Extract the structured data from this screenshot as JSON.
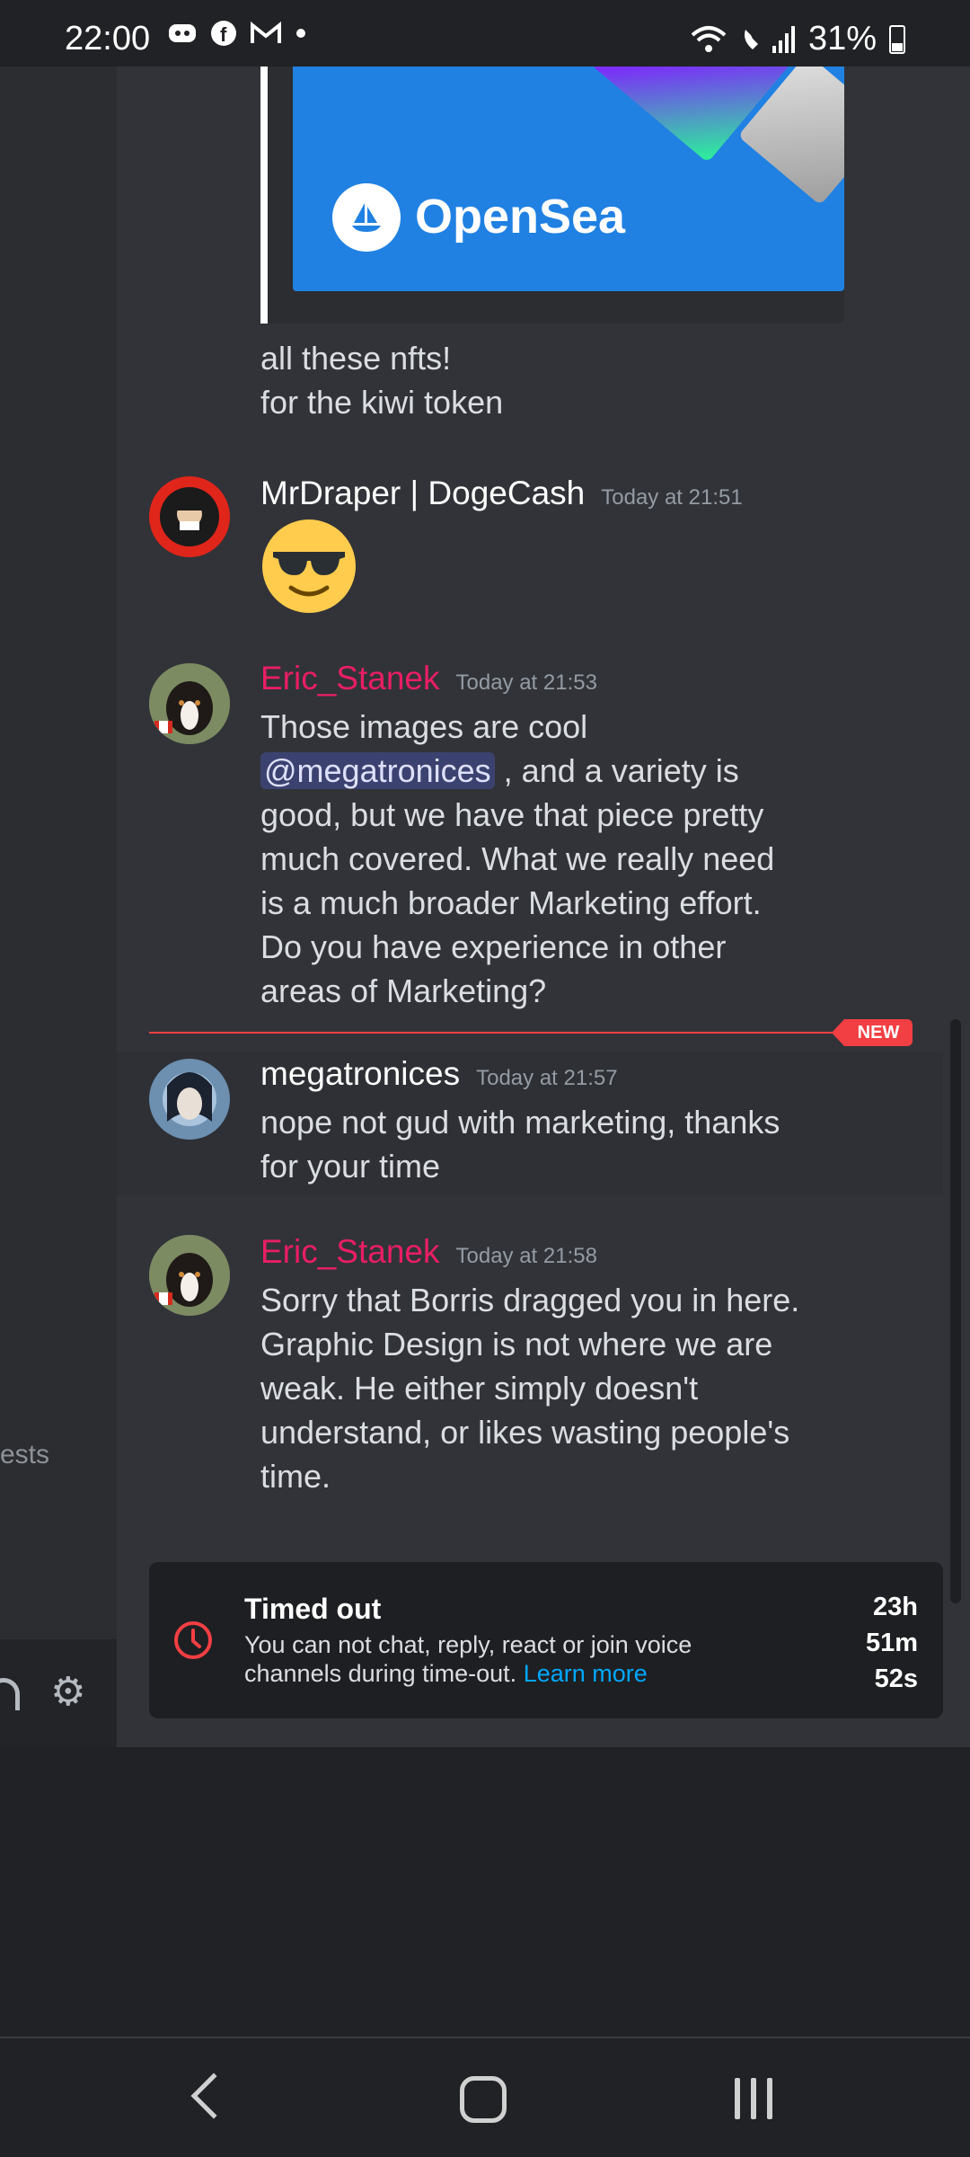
{
  "status_bar": {
    "time": "22:00",
    "notification_icons": [
      "discord-icon",
      "facebook-icon",
      "gmail-icon",
      "dot-icon"
    ],
    "battery": "31%"
  },
  "sidebar": {
    "fragment_text": "ests"
  },
  "embed": {
    "brand": "OpenSea"
  },
  "messages": [
    {
      "lines": [
        "all these nfts!",
        "for the kiwi token"
      ]
    },
    {
      "author": "MrDraper | DogeCash",
      "author_color": "#ffffff",
      "timestamp": "Today at 21:51",
      "emoji": "sunglasses-emoji"
    },
    {
      "author": "Eric_Stanek",
      "author_color": "#e91e63",
      "timestamp": "Today at 21:53",
      "line1": "Those images are cool",
      "mention": "@megatronices",
      "line2_rest": ", and a variety is",
      "line3": "good, but we have that piece pretty",
      "line4": "much covered. What we really need",
      "line5": "is a much broader Marketing effort.",
      "line6": "Do you have experience in other",
      "line7": "areas of Marketing?"
    },
    {
      "author": "megatronices",
      "author_color": "#ffffff",
      "timestamp": "Today at 21:57",
      "line1": "nope not gud with marketing, thanks",
      "line2": "for your time"
    },
    {
      "author": "Eric_Stanek",
      "author_color": "#e91e63",
      "timestamp": "Today at 21:58",
      "line1": "Sorry that Borris dragged you in here.",
      "line2": "Graphic Design is not where we are",
      "line3": "weak. He either simply doesn't",
      "line4": "understand, or likes wasting people's",
      "line5": "time."
    }
  ],
  "new_badge": "NEW",
  "timeout": {
    "title": "Timed out",
    "desc_line1": "You can not chat, reply, react or join voice",
    "desc_line2": "channels during time-out.",
    "learn_more": "Learn more",
    "hours": "23h",
    "minutes": "51m",
    "seconds": "52s"
  },
  "colors": {
    "accent_red": "#f23f43",
    "link_blue": "#00a8fc",
    "role_pink": "#e91e63"
  }
}
